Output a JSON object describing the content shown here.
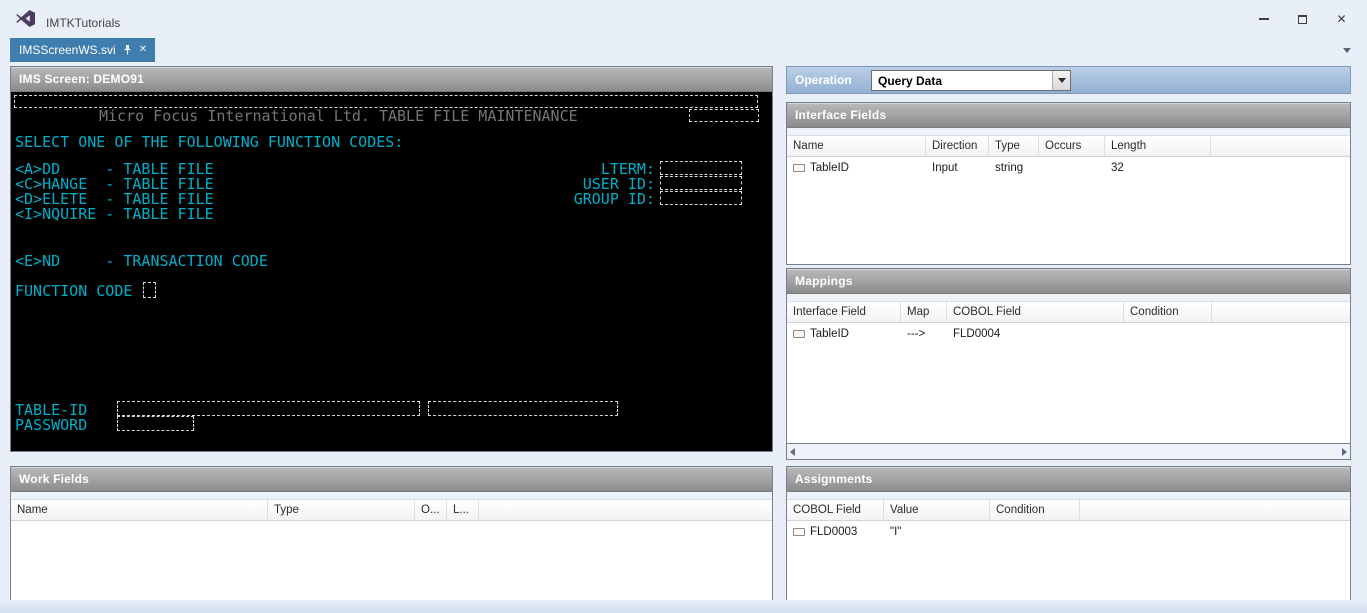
{
  "window": {
    "title": "IMTKTutorials"
  },
  "icons": {
    "close": "✕"
  },
  "doc_tab": {
    "label": "IMSScreenWS.svi"
  },
  "ims_screen": {
    "title": "IMS Screen: DEMO91",
    "banner": "Micro Focus International Ltd. TABLE FILE MAINTENANCE",
    "select_prompt": "SELECT ONE OF THE FOLLOWING FUNCTION CODES:",
    "function_codes": [
      "<A>DD     - TABLE FILE",
      "<C>HANGE  - TABLE FILE",
      "<D>ELETE  - TABLE FILE",
      "<I>NQUIRE - TABLE FILE"
    ],
    "end_code": "<E>ND     - TRANSACTION CODE",
    "function_code_label": "FUNCTION CODE",
    "lterm_label": "LTERM:",
    "user_id_label": "USER ID:",
    "group_id_label": "GROUP ID:",
    "table_id_label": "TABLE-ID",
    "password_label": "PASSWORD"
  },
  "operation": {
    "label": "Operation",
    "selected": "Query Data"
  },
  "interface_fields": {
    "title": "Interface Fields",
    "columns": [
      "Name",
      "Direction",
      "Type",
      "Occurs",
      "Length"
    ],
    "rows": [
      {
        "name": "TableID",
        "direction": "Input",
        "type": "string",
        "occurs": "",
        "length": "32"
      }
    ]
  },
  "mappings": {
    "title": "Mappings",
    "columns": [
      "Interface Field",
      "Map",
      "COBOL Field",
      "Condition"
    ],
    "rows": [
      {
        "interface_field": "TableID",
        "map": "--->",
        "cobol_field": "FLD0004",
        "condition": ""
      }
    ]
  },
  "assignments": {
    "title": "Assignments",
    "columns": [
      "COBOL Field",
      "Value",
      "Condition"
    ],
    "rows": [
      {
        "cobol_field": "FLD0003",
        "value": "\"I\"",
        "condition": ""
      }
    ]
  },
  "work_fields": {
    "title": "Work Fields",
    "columns": [
      "Name",
      "Type",
      "O...",
      "L..."
    ]
  }
}
